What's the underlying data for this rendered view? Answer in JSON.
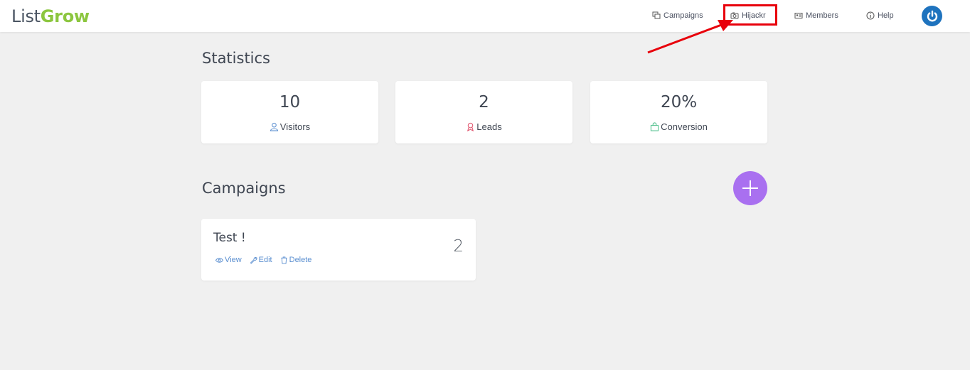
{
  "brand": {
    "part1": "List",
    "part2": "Grow"
  },
  "nav": {
    "campaigns": "Campaigns",
    "hijackr": "Hijackr",
    "members": "Members",
    "help": "Help"
  },
  "statistics": {
    "title": "Statistics",
    "cards": [
      {
        "value": "10",
        "label": "Visitors",
        "icon": "user-icon",
        "icon_color": "#5b8fd0"
      },
      {
        "value": "2",
        "label": "Leads",
        "icon": "ribbon-icon",
        "icon_color": "#e0506a"
      },
      {
        "value": "20%",
        "label": "Conversion",
        "icon": "bag-icon",
        "icon_color": "#4cbf8a"
      }
    ]
  },
  "campaigns": {
    "title": "Campaigns",
    "items": [
      {
        "name": "Test !",
        "count": "2",
        "view": "View",
        "edit": "Edit",
        "delete": "Delete"
      }
    ]
  },
  "colors": {
    "accent_purple": "#a970f0",
    "power_blue": "#1e73be",
    "highlight_red": "#e8000b",
    "brand_green": "#8cc63f"
  }
}
